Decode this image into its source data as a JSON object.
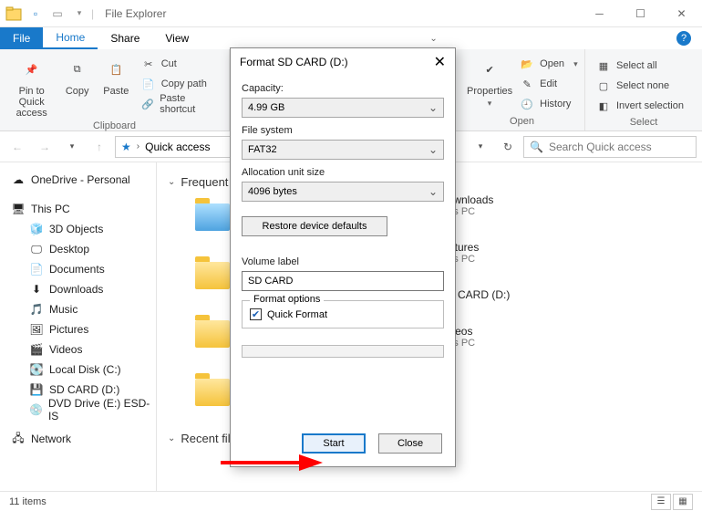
{
  "window": {
    "title": "File Explorer"
  },
  "tabs": {
    "file": "File",
    "home": "Home",
    "share": "Share",
    "view": "View"
  },
  "ribbon": {
    "pin": "Pin to Quick access",
    "copy": "Copy",
    "paste": "Paste",
    "cut": "Cut",
    "copypath": "Copy path",
    "pasteshort": "Paste shortcut",
    "clipboard_label": "Clipboard",
    "properties": "Properties",
    "open": "Open",
    "edit": "Edit",
    "history": "History",
    "open_label": "Open",
    "selectall": "Select all",
    "selectnone": "Select none",
    "invert": "Invert selection",
    "select_label": "Select"
  },
  "nav": {
    "location": "Quick access",
    "search_placeholder": "Search Quick access"
  },
  "tree": {
    "onedrive": "OneDrive - Personal",
    "thispc": "This PC",
    "objects3d": "3D Objects",
    "desktop": "Desktop",
    "documents": "Documents",
    "downloads": "Downloads",
    "music": "Music",
    "pictures": "Pictures",
    "videos": "Videos",
    "localdisk": "Local Disk (C:)",
    "sdcard": "SD CARD (D:)",
    "dvd": "DVD Drive (E:) ESD-IS",
    "network": "Network"
  },
  "content": {
    "frequent": "Frequent folders",
    "recent": "Recent files",
    "right": [
      {
        "title": "Downloads",
        "sub": "This PC"
      },
      {
        "title": "Pictures",
        "sub": "This PC"
      },
      {
        "title": "SD CARD (D:)",
        "sub": ""
      },
      {
        "title": "Videos",
        "sub": "This PC"
      }
    ]
  },
  "status": {
    "items": "11 items"
  },
  "dialog": {
    "title": "Format SD CARD (D:)",
    "capacity_label": "Capacity:",
    "capacity": "4.99 GB",
    "fs_label": "File system",
    "fs": "FAT32",
    "alloc_label": "Allocation unit size",
    "alloc": "4096 bytes",
    "restore": "Restore device defaults",
    "vol_label": "Volume label",
    "vol": "SD CARD",
    "opts_label": "Format options",
    "quick": "Quick Format",
    "start": "Start",
    "close": "Close"
  }
}
